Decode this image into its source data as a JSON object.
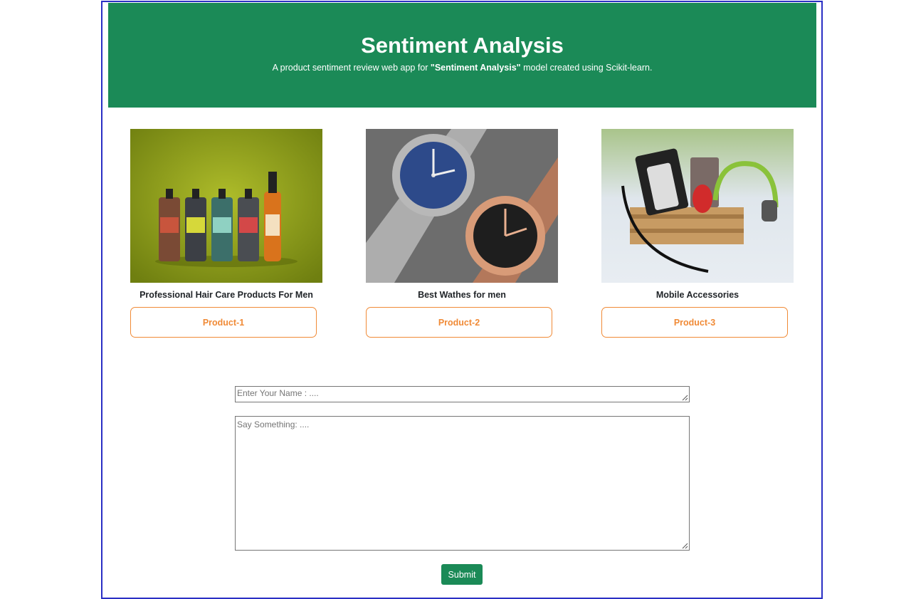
{
  "header": {
    "title": "Sentiment Analysis",
    "subtitle_prefix": "A product sentiment review web app for ",
    "subtitle_bold": "\"Sentiment Analysis\"",
    "subtitle_suffix": " model created using Scikit-learn."
  },
  "products": [
    {
      "caption": "Professional Hair Care Products For Men",
      "button": "Product-1",
      "image": "hair-care-bottles"
    },
    {
      "caption": "Best Wathes for men",
      "button": "Product-2",
      "image": "wrist-watches"
    },
    {
      "caption": "Mobile Accessories",
      "button": "Product-3",
      "image": "mobile-accessories-crate"
    }
  ],
  "form": {
    "name_placeholder": "Enter Your Name : ....",
    "message_placeholder": "Say Something: ....",
    "submit_label": "Submit"
  },
  "colors": {
    "brand_green": "#1b8a57",
    "accent_orange": "#f08a36",
    "frame_blue": "#2a2fc4"
  }
}
